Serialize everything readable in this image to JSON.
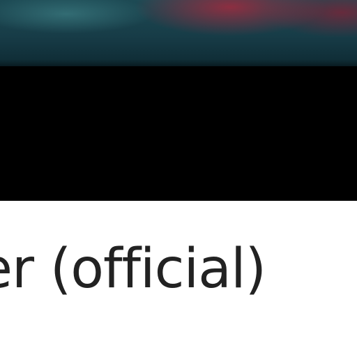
{
  "video": {
    "title_fragment": "er (official)"
  }
}
